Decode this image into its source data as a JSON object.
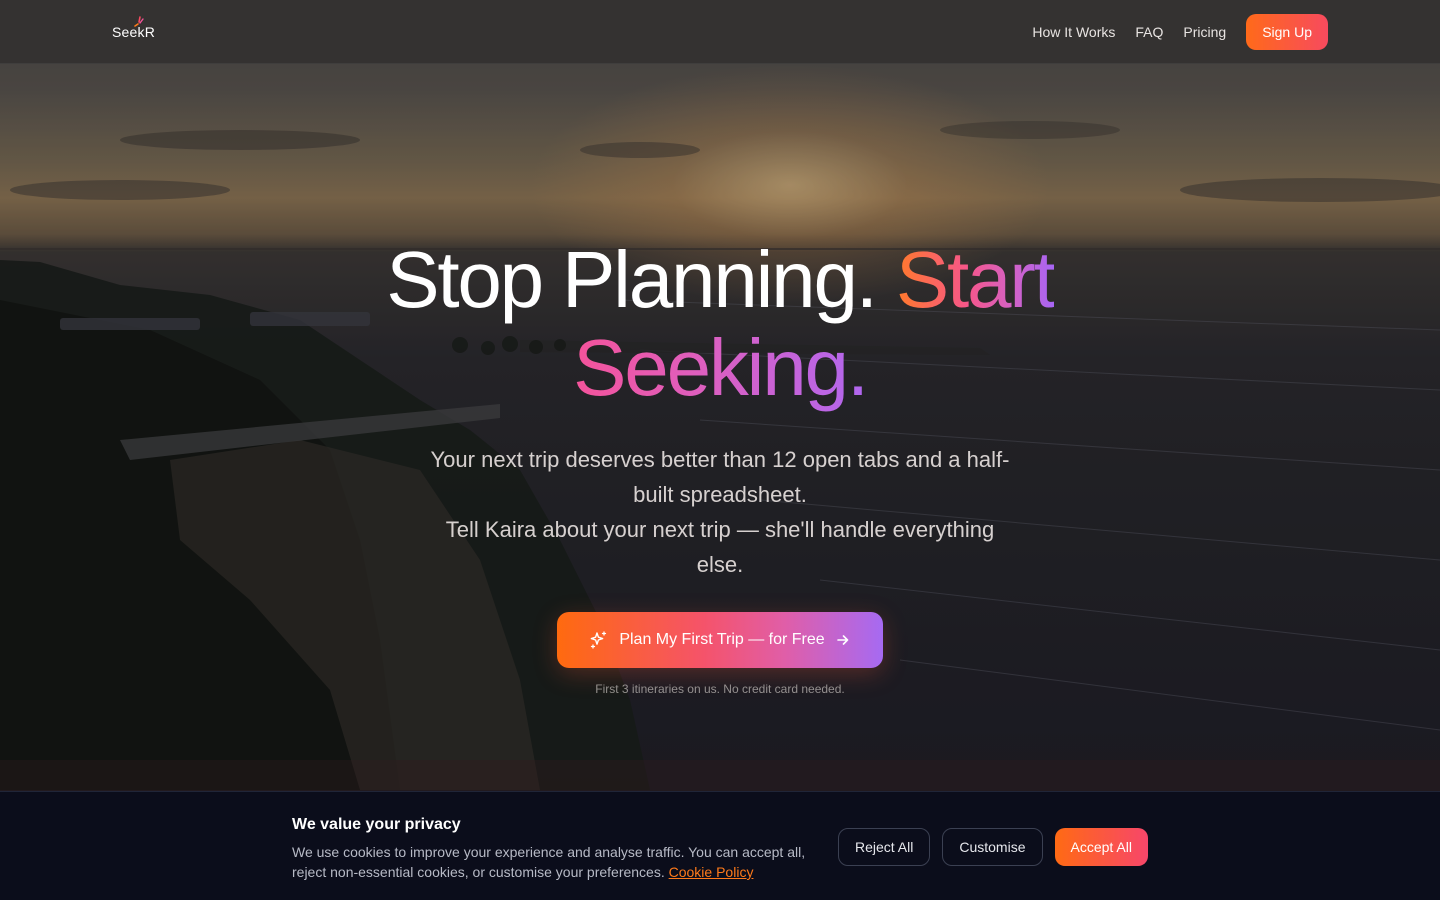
{
  "brand": {
    "name": "SeekR"
  },
  "nav": {
    "links": [
      {
        "label": "How It Works"
      },
      {
        "label": "FAQ"
      },
      {
        "label": "Pricing"
      }
    ],
    "signup_label": "Sign Up"
  },
  "hero": {
    "title_part1": "Stop Planning. ",
    "title_accent1": "Start",
    "title_accent2": "Seeking.",
    "subtitle_line1": "Your next trip deserves better than 12 open tabs and a half-built spreadsheet.",
    "subtitle_line2": "Tell Kaira about your next trip — she'll handle everything else.",
    "cta_label": "Plan My First Trip — for Free",
    "cta_note": "First 3 itineraries on us. No credit card needed."
  },
  "cookie": {
    "title": "We value your privacy",
    "description": "We use cookies to improve your experience and analyse traffic. You can accept all, reject non-essential cookies, or customise your preferences. ",
    "link_label": "Cookie Policy",
    "reject_label": "Reject All",
    "customise_label": "Customise",
    "accept_label": "Accept All"
  },
  "icons": {
    "cta_leading": "sparkles-icon",
    "cta_trailing": "arrow-right-icon",
    "logo_mark": "spark-mark-icon"
  },
  "colors": {
    "accent_orange": "#ff6a1a",
    "accent_pink": "#f74a5e",
    "accent_purple": "#a66af2",
    "cookie_bg": "#0b0d1b",
    "cookie_link": "#ff7a1a"
  }
}
